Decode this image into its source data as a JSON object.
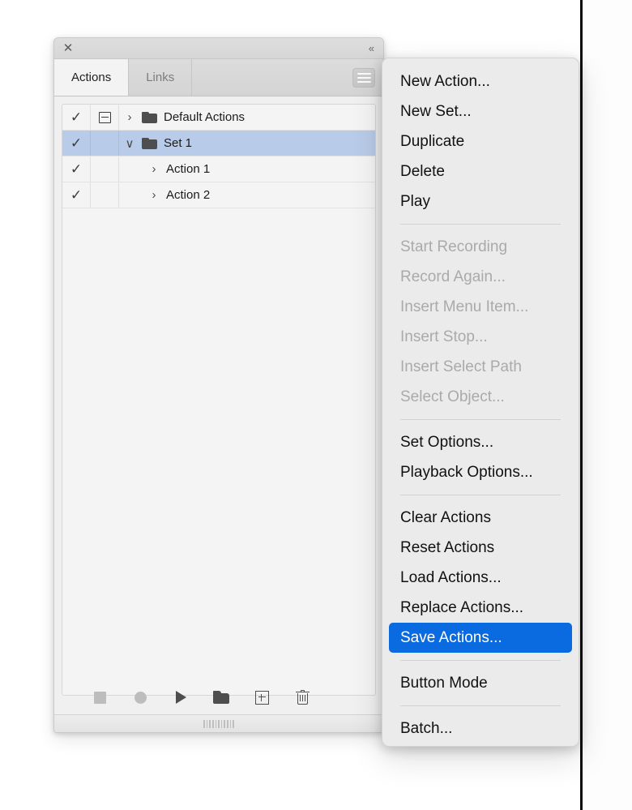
{
  "panel": {
    "titlebar": {
      "close_icon": "close-icon",
      "collapse_label": "«"
    },
    "tabs": [
      {
        "label": "Actions",
        "active": true
      },
      {
        "label": "Links",
        "active": false
      }
    ],
    "options_button_icon": "hamburger-menu-icon",
    "rows": [
      {
        "label": "Default Actions",
        "checked": true,
        "check_glyph": "✓",
        "has_dialog_toggle": true,
        "expanded": false,
        "twisty_glyph": "›",
        "has_folder": true,
        "indented": false,
        "selected": false
      },
      {
        "label": "Set 1",
        "checked": true,
        "check_glyph": "✓",
        "has_dialog_toggle": false,
        "expanded": true,
        "twisty_glyph": "∨",
        "has_folder": true,
        "indented": false,
        "selected": true
      },
      {
        "label": "Action 1",
        "checked": true,
        "check_glyph": "✓",
        "has_dialog_toggle": false,
        "expanded": false,
        "twisty_glyph": "›",
        "has_folder": false,
        "indented": true,
        "selected": false
      },
      {
        "label": "Action 2",
        "checked": true,
        "check_glyph": "✓",
        "has_dialog_toggle": false,
        "expanded": false,
        "twisty_glyph": "›",
        "has_folder": false,
        "indented": true,
        "selected": false
      }
    ],
    "toolbar": [
      {
        "name": "stop-button",
        "icon": "stop-icon",
        "enabled": false
      },
      {
        "name": "record-button",
        "icon": "record-icon",
        "enabled": false
      },
      {
        "name": "play-button",
        "icon": "play-icon",
        "enabled": true
      },
      {
        "name": "new-set-button",
        "icon": "folder-icon",
        "enabled": true
      },
      {
        "name": "new-action-button",
        "icon": "plus-box-icon",
        "enabled": true
      },
      {
        "name": "delete-button",
        "icon": "trash-icon",
        "enabled": true
      }
    ],
    "resize_grip_icon": "resize-grip-icon"
  },
  "menu": {
    "items": [
      {
        "label": "New Action...",
        "state": "enabled"
      },
      {
        "label": "New Set...",
        "state": "enabled"
      },
      {
        "label": "Duplicate",
        "state": "enabled"
      },
      {
        "label": "Delete",
        "state": "enabled"
      },
      {
        "label": "Play",
        "state": "enabled"
      },
      {
        "separator": true
      },
      {
        "label": "Start Recording",
        "state": "disabled"
      },
      {
        "label": "Record Again...",
        "state": "disabled"
      },
      {
        "label": "Insert Menu Item...",
        "state": "disabled"
      },
      {
        "label": "Insert Stop...",
        "state": "disabled"
      },
      {
        "label": "Insert Select Path",
        "state": "disabled"
      },
      {
        "label": "Select Object...",
        "state": "disabled"
      },
      {
        "separator": true
      },
      {
        "label": "Set Options...",
        "state": "enabled"
      },
      {
        "label": "Playback Options...",
        "state": "enabled"
      },
      {
        "separator": true
      },
      {
        "label": "Clear Actions",
        "state": "enabled"
      },
      {
        "label": "Reset Actions",
        "state": "enabled"
      },
      {
        "label": "Load Actions...",
        "state": "enabled"
      },
      {
        "label": "Replace Actions...",
        "state": "enabled"
      },
      {
        "label": "Save Actions...",
        "state": "highlighted"
      },
      {
        "separator": true
      },
      {
        "label": "Button Mode",
        "state": "enabled"
      },
      {
        "separator": true
      },
      {
        "label": "Batch...",
        "state": "enabled"
      }
    ]
  },
  "colors": {
    "highlight_blue": "#0a6ae0",
    "selection_blue": "#b8cbe8",
    "menu_bg": "#ebebeb",
    "panel_bg": "#f0f0f0"
  }
}
